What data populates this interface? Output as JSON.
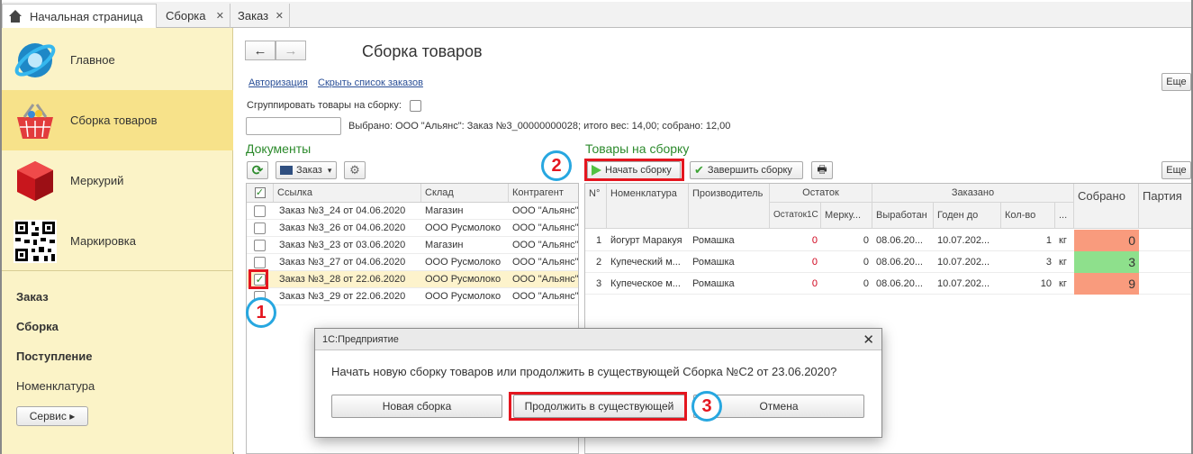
{
  "tabs": [
    {
      "label": "Начальная страница"
    },
    {
      "label": "Сборка",
      "close": "✕"
    },
    {
      "label": "Заказ",
      "close": "✕"
    }
  ],
  "sidebar": {
    "sections": [
      {
        "label": "Главное"
      },
      {
        "label": "Сборка товаров"
      },
      {
        "label": "Меркурий"
      },
      {
        "label": "Маркировка"
      }
    ],
    "links": [
      {
        "label": "Заказ"
      },
      {
        "label": "Сборка"
      },
      {
        "label": "Поступление"
      },
      {
        "label": "Номенклатура"
      }
    ],
    "service_button": "Сервис ▸"
  },
  "main": {
    "back": "←",
    "forward": "→",
    "title": "Сборка товаров",
    "more_button": "Еще",
    "links": {
      "auth": "Авторизация",
      "hide_orders": "Скрыть список  заказов"
    },
    "group_label": "Сгруппировать товары на сборку:",
    "selected_text": "Выбрано:  ООО \"Альянс\": Заказ №3_00000000028; итого вес: 14,00; собрано: 12,00"
  },
  "documents": {
    "title": "Документы",
    "toolbar": {
      "refresh": "⟳",
      "order_button": "Заказ",
      "order_caret": "▾",
      "settings": "⚙"
    },
    "columns": [
      "Ссылка",
      "Склад",
      "Контрагент"
    ],
    "rows": [
      {
        "link": "Заказ №3_24 от 04.06.2020",
        "warehouse": "Магазин",
        "counterparty": "ООО \"Альянс\"",
        "checked": false
      },
      {
        "link": "Заказ №3_26 от 04.06.2020",
        "warehouse": "ООО Русмолоко",
        "counterparty": "ООО \"Альянс\"",
        "checked": false
      },
      {
        "link": "Заказ №3_23 от 03.06.2020",
        "warehouse": "Магазин",
        "counterparty": "ООО \"Альянс\"",
        "checked": false
      },
      {
        "link": "Заказ №3_27 от 04.06.2020",
        "warehouse": "ООО Русмолоко",
        "counterparty": "ООО \"Альянс\"",
        "checked": false
      },
      {
        "link": "Заказ №3_28 от 22.06.2020",
        "warehouse": "ООО Русмолоко",
        "counterparty": "ООО \"Альянс\"",
        "checked": true
      },
      {
        "link": "Заказ №3_29 от 22.06.2020",
        "warehouse": "ООО Русмолоко",
        "counterparty": "ООО \"Альянс\"",
        "checked": false
      }
    ]
  },
  "goods": {
    "title": "Товары на сборку",
    "toolbar": {
      "start": "Начать  сборку",
      "finish": "Завершить  сборку",
      "print": "🖶",
      "more": "Еще"
    },
    "columns": {
      "num": "N°",
      "nomenclature": "Номенклатура",
      "manufacturer": "Производитель",
      "stock": "Остаток",
      "stock1": "Остаток1С",
      "stock_merc": "Мерку...",
      "ordered": "Заказано",
      "produced": "Выработан",
      "valid_to": "Годен до",
      "qty": "Кол-во",
      "unit": "...",
      "collected": "Собрано",
      "batch": "Партия"
    },
    "rows": [
      {
        "n": "1",
        "name": "йогурт Маракуя",
        "maker": "Ромашка",
        "stock1": "0",
        "merc": "0",
        "produced": "08.06.20...",
        "valid": "10.07.202...",
        "qty": "1",
        "unit": "кг",
        "collected": "0",
        "color": "#f99b7d"
      },
      {
        "n": "2",
        "name": "Купеческий м...",
        "maker": "Ромашка",
        "stock1": "0",
        "merc": "0",
        "produced": "08.06.20...",
        "valid": "10.07.202...",
        "qty": "3",
        "unit": "кг",
        "collected": "3",
        "color": "#8ee08c"
      },
      {
        "n": "3",
        "name": "Купеческое м...",
        "maker": "Ромашка",
        "stock1": "0",
        "merc": "0",
        "produced": "08.06.20...",
        "valid": "10.07.202...",
        "qty": "10",
        "unit": "кг",
        "collected": "9",
        "color": "#f99b7d"
      }
    ]
  },
  "dialog": {
    "title": "1С:Предприятие",
    "close": "✕",
    "message": "Начать новую сборку товаров или продолжить в существующей Сборка №С2 от 23.06.2020?",
    "buttons": {
      "new": "Новая сборка",
      "continue": "Продолжить в существующей",
      "cancel": "Отмена"
    }
  },
  "annotations": [
    "1",
    "2",
    "3"
  ],
  "colors": {
    "accent_red": "#e4161f",
    "badge_blue": "#27a7e0",
    "sidebar_bg": "#fbf3c7",
    "section_title": "#2c8a2c"
  }
}
